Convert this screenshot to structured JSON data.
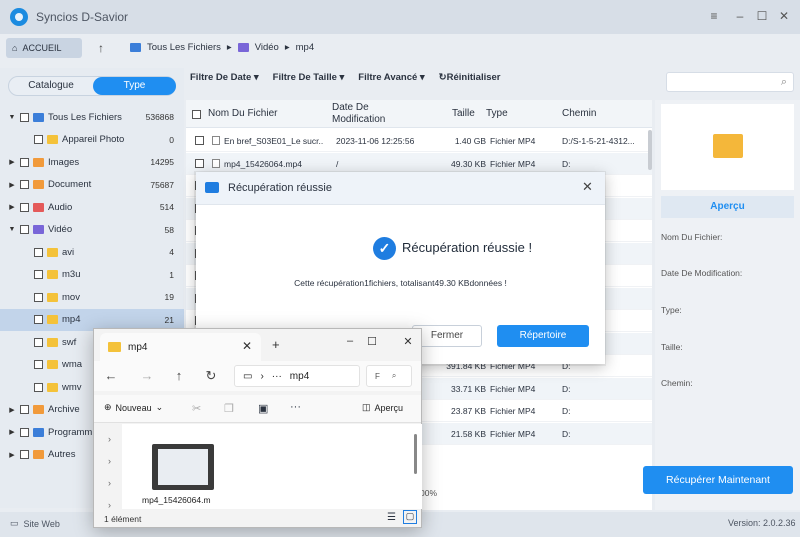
{
  "app": {
    "title": "Syncios D-Savior",
    "version": "Version: 2.0.2.36"
  },
  "window_controls": [
    "≡",
    "–",
    "☐",
    "✕"
  ],
  "nav": {
    "home": "ACCUEIL",
    "crumbs": [
      "Tous Les Fichiers",
      "Vidéo",
      "mp4"
    ]
  },
  "sidebar": {
    "tabs": [
      "Catalogue",
      "Type"
    ],
    "items": [
      {
        "label": "Tous Les Fichiers",
        "count": "536868",
        "level": 0,
        "caret": "▼"
      },
      {
        "label": "Appareil Photo",
        "count": "0",
        "level": 1,
        "caret": ""
      },
      {
        "label": "Images",
        "count": "14295",
        "level": 0,
        "caret": "▶"
      },
      {
        "label": "Document",
        "count": "75687",
        "level": 0,
        "caret": "▶"
      },
      {
        "label": "Audio",
        "count": "514",
        "level": 0,
        "caret": "▶"
      },
      {
        "label": "Vidéo",
        "count": "58",
        "level": 0,
        "caret": "▼"
      },
      {
        "label": "avi",
        "count": "4",
        "level": 1,
        "caret": ""
      },
      {
        "label": "m3u",
        "count": "1",
        "level": 1,
        "caret": ""
      },
      {
        "label": "mov",
        "count": "19",
        "level": 1,
        "caret": ""
      },
      {
        "label": "mp4",
        "count": "21",
        "level": 1,
        "caret": ""
      },
      {
        "label": "swf",
        "count": "",
        "level": 1,
        "caret": ""
      },
      {
        "label": "wma",
        "count": "",
        "level": 1,
        "caret": ""
      },
      {
        "label": "wmv",
        "count": "",
        "level": 1,
        "caret": ""
      },
      {
        "label": "Archive",
        "count": "",
        "level": 0,
        "caret": "▶"
      },
      {
        "label": "Programm",
        "count": "",
        "level": 0,
        "caret": "▶"
      },
      {
        "label": "Autres",
        "count": "",
        "level": 0,
        "caret": "▶"
      }
    ]
  },
  "filters": [
    "Filtre De Date ▾",
    "Filtre De Taille ▾",
    "Filtre Avancé ▾",
    "↻Réinitialiser"
  ],
  "table": {
    "headers": [
      "Nom Du Fichier",
      "Date De Modification",
      "Taille",
      "Type",
      "Chemin"
    ],
    "rows": [
      {
        "name": "En bref_S03E01_Le sucr...",
        "date": "2023-11-06 12:25:56",
        "size": "1.40 GB",
        "type": "Fichier MP4",
        "path": "D:/S-1-5-21-4312..."
      },
      {
        "name": "mp4_15426064.mp4",
        "date": "/",
        "size": "49.30 KB",
        "type": "Fichier MP4",
        "path": "D:"
      },
      {
        "name": "",
        "date": "",
        "size": "",
        "type": "",
        "path": ""
      },
      {
        "name": "",
        "date": "",
        "size": "",
        "type": "",
        "path": ""
      },
      {
        "name": "",
        "date": "",
        "size": "",
        "type": "",
        "path": ""
      },
      {
        "name": "",
        "date": "",
        "size": "",
        "type": "",
        "path": ""
      },
      {
        "name": "",
        "date": "",
        "size": "",
        "type": "",
        "path": ""
      },
      {
        "name": "",
        "date": "",
        "size": "",
        "type": "",
        "path": ""
      },
      {
        "name": "",
        "date": "",
        "size": "",
        "type": "",
        "path": ""
      },
      {
        "name": "",
        "date": "",
        "size": "",
        "type": "",
        "path": ""
      },
      {
        "name": "",
        "date": "",
        "size": "391.84 KB",
        "type": "Fichier MP4",
        "path": "D:"
      },
      {
        "name": "",
        "date": "",
        "size": "33.71 KB",
        "type": "Fichier MP4",
        "path": "D:"
      },
      {
        "name": "",
        "date": "",
        "size": "23.87 KB",
        "type": "Fichier MP4",
        "path": "D:"
      },
      {
        "name": "",
        "date": "",
        "size": "21.58 KB",
        "type": "Fichier MP4",
        "path": "D:"
      }
    ]
  },
  "panel": {
    "apercu": "Aperçu",
    "labels": [
      "Nom Du Fichier:",
      "Date De Modification:",
      "Type:",
      "Taille:",
      "Chemin:"
    ]
  },
  "recover_button": "Récupérer Maintenant",
  "status": {
    "site": "Site Web",
    "pct": "00%"
  },
  "dialog": {
    "title": "Récupération réussie",
    "headline": "Récupération réussie !",
    "message": "Cette récupération1fichiers, totalisant49.30 KBdonnées !",
    "cancel": "Fermer",
    "ok": "Répertoire"
  },
  "explorer": {
    "tab": "mp4",
    "address": "mp4",
    "search": "F",
    "new": "Nouveau",
    "apercu": "Aperçu",
    "file": "mp4_15426064.m",
    "status": "1 élément"
  }
}
